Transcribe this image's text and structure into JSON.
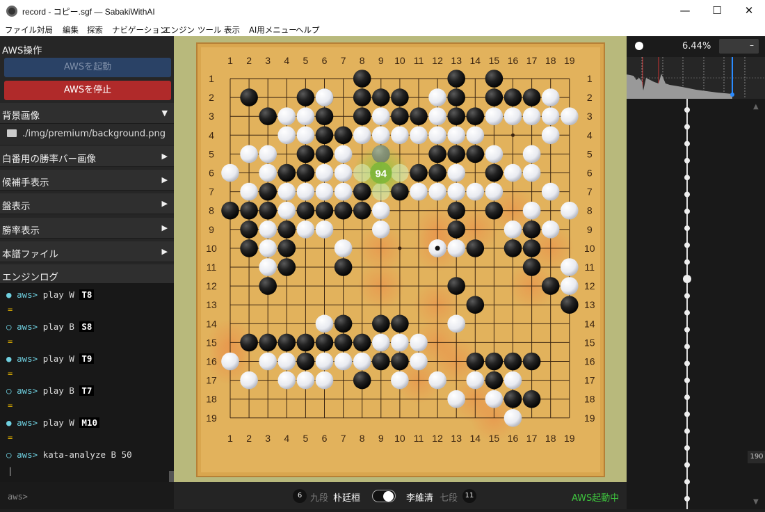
{
  "window": {
    "title": "record - コピー.sgf — SabakiWithAI",
    "minimize": "—",
    "maximize": "☐",
    "close": "✕"
  },
  "menu": [
    "ファイル",
    "対局",
    "編集",
    "探索",
    "ナビゲーション",
    "エンジン",
    "ツール",
    "表示",
    "AI用メニュー",
    "ヘルプ"
  ],
  "sidebar": {
    "aws_header": "AWS操作",
    "start_button": "AWSを起動",
    "stop_button": "AWSを停止",
    "background_header": "背景画像",
    "background_path": "./img/premium/background.png",
    "sections": [
      "白番用の勝率バー画像",
      "候補手表示",
      "盤表示",
      "勝率表示",
      "本譜ファイル"
    ],
    "log_header": "エンジンログ",
    "log": [
      {
        "dot": "●",
        "prefix": "aws>",
        "cmd": "play W",
        "arg": "T8"
      },
      {
        "eq": "="
      },
      {
        "dot": "○",
        "prefix": "aws>",
        "cmd": "play B",
        "arg": "S8"
      },
      {
        "eq": "="
      },
      {
        "dot": "●",
        "prefix": "aws>",
        "cmd": "play W",
        "arg": "T9"
      },
      {
        "eq": "="
      },
      {
        "dot": "○",
        "prefix": "aws>",
        "cmd": "play B",
        "arg": "T7"
      },
      {
        "eq": "="
      },
      {
        "dot": "●",
        "prefix": "aws>",
        "cmd": "play W",
        "arg": "M10"
      },
      {
        "eq": "="
      },
      {
        "dot": "○",
        "prefix": "aws>",
        "cmd": "kata-analyze B 50",
        "arg": ""
      }
    ],
    "console_prompt": "aws>",
    "cursor": "|"
  },
  "board": {
    "size": 19,
    "candidate_label": "94",
    "candidate_point": [
      9,
      6
    ],
    "black": [
      [
        8,
        1
      ],
      [
        13,
        1
      ],
      [
        15,
        1
      ],
      [
        2,
        2
      ],
      [
        5,
        2
      ],
      [
        6,
        2
      ],
      [
        8,
        2
      ],
      [
        9,
        2
      ],
      [
        10,
        2
      ],
      [
        13,
        2
      ],
      [
        15,
        2
      ],
      [
        16,
        2
      ],
      [
        17,
        2
      ],
      [
        3,
        3
      ],
      [
        6,
        3
      ],
      [
        8,
        3
      ],
      [
        10,
        3
      ],
      [
        11,
        3
      ],
      [
        13,
        3
      ],
      [
        14,
        3
      ],
      [
        6,
        4
      ],
      [
        7,
        4
      ],
      [
        5,
        5
      ],
      [
        6,
        5
      ],
      [
        9,
        5
      ],
      [
        12,
        5
      ],
      [
        13,
        5
      ],
      [
        14,
        5
      ],
      [
        4,
        6
      ],
      [
        5,
        6
      ],
      [
        11,
        6
      ],
      [
        12,
        6
      ],
      [
        15,
        6
      ],
      [
        3,
        7
      ],
      [
        8,
        7
      ],
      [
        10,
        7
      ],
      [
        1,
        8
      ],
      [
        2,
        8
      ],
      [
        3,
        8
      ],
      [
        5,
        8
      ],
      [
        6,
        8
      ],
      [
        7,
        8
      ],
      [
        8,
        8
      ],
      [
        13,
        8
      ],
      [
        15,
        8
      ],
      [
        2,
        9
      ],
      [
        4,
        9
      ],
      [
        13,
        9
      ],
      [
        17,
        9
      ],
      [
        2,
        10
      ],
      [
        4,
        10
      ],
      [
        14,
        10
      ],
      [
        16,
        10
      ],
      [
        17,
        10
      ],
      [
        4,
        11
      ],
      [
        7,
        11
      ],
      [
        17,
        11
      ],
      [
        3,
        12
      ],
      [
        13,
        12
      ],
      [
        18,
        12
      ],
      [
        14,
        13
      ],
      [
        19,
        13
      ],
      [
        7,
        14
      ],
      [
        9,
        14
      ],
      [
        10,
        14
      ],
      [
        2,
        15
      ],
      [
        3,
        15
      ],
      [
        4,
        15
      ],
      [
        5,
        15
      ],
      [
        6,
        15
      ],
      [
        7,
        15
      ],
      [
        8,
        15
      ],
      [
        9,
        15
      ],
      [
        5,
        16
      ],
      [
        9,
        16
      ],
      [
        10,
        16
      ],
      [
        14,
        16
      ],
      [
        15,
        16
      ],
      [
        16,
        16
      ],
      [
        17,
        16
      ],
      [
        8,
        17
      ],
      [
        15,
        17
      ],
      [
        16,
        18
      ],
      [
        17,
        18
      ]
    ],
    "white": [
      [
        6,
        2
      ],
      [
        12,
        2
      ],
      [
        18,
        2
      ],
      [
        4,
        3
      ],
      [
        5,
        3
      ],
      [
        9,
        3
      ],
      [
        12,
        3
      ],
      [
        15,
        3
      ],
      [
        16,
        3
      ],
      [
        17,
        3
      ],
      [
        18,
        3
      ],
      [
        19,
        3
      ],
      [
        4,
        4
      ],
      [
        5,
        4
      ],
      [
        8,
        4
      ],
      [
        9,
        4
      ],
      [
        10,
        4
      ],
      [
        11,
        4
      ],
      [
        12,
        4
      ],
      [
        13,
        4
      ],
      [
        14,
        4
      ],
      [
        18,
        4
      ],
      [
        2,
        5
      ],
      [
        3,
        5
      ],
      [
        7,
        5
      ],
      [
        15,
        5
      ],
      [
        17,
        5
      ],
      [
        1,
        6
      ],
      [
        3,
        6
      ],
      [
        6,
        6
      ],
      [
        7,
        6
      ],
      [
        13,
        6
      ],
      [
        16,
        6
      ],
      [
        17,
        6
      ],
      [
        2,
        7
      ],
      [
        4,
        7
      ],
      [
        5,
        7
      ],
      [
        6,
        7
      ],
      [
        7,
        7
      ],
      [
        11,
        7
      ],
      [
        12,
        7
      ],
      [
        13,
        7
      ],
      [
        14,
        7
      ],
      [
        15,
        7
      ],
      [
        18,
        7
      ],
      [
        4,
        8
      ],
      [
        9,
        8
      ],
      [
        17,
        8
      ],
      [
        19,
        8
      ],
      [
        3,
        9
      ],
      [
        5,
        9
      ],
      [
        6,
        9
      ],
      [
        9,
        9
      ],
      [
        16,
        9
      ],
      [
        18,
        9
      ],
      [
        3,
        10
      ],
      [
        7,
        10
      ],
      [
        12,
        10
      ],
      [
        13,
        10
      ],
      [
        3,
        11
      ],
      [
        19,
        11
      ],
      [
        19,
        12
      ],
      [
        13,
        14
      ],
      [
        6,
        14
      ],
      [
        9,
        15
      ],
      [
        10,
        15
      ],
      [
        11,
        15
      ],
      [
        1,
        16
      ],
      [
        3,
        16
      ],
      [
        4,
        16
      ],
      [
        6,
        16
      ],
      [
        7,
        16
      ],
      [
        8,
        16
      ],
      [
        11,
        16
      ],
      [
        2,
        17
      ],
      [
        4,
        17
      ],
      [
        5,
        17
      ],
      [
        6,
        17
      ],
      [
        10,
        17
      ],
      [
        12,
        17
      ],
      [
        14,
        17
      ],
      [
        16,
        17
      ],
      [
        13,
        18
      ],
      [
        15,
        18
      ],
      [
        16,
        19
      ]
    ],
    "hints": [
      [
        9,
        5
      ],
      [
        8,
        6
      ],
      [
        10,
        6
      ],
      [
        9,
        7
      ]
    ],
    "last_move": [
      12,
      10
    ],
    "colors": {
      "wood": "#e2b25c",
      "frame": "#d9a64e",
      "line": "#3a2410",
      "tatami": "#b8b97c",
      "candidate": "#8cbf3a"
    }
  },
  "players": {
    "black_count": "6",
    "black_rank": "九段",
    "black_name": "朴廷桓",
    "white_name": "李維清",
    "white_rank": "七段",
    "white_count": "11",
    "status": "AWS起動中"
  },
  "rightpanel": {
    "winrate": "6.44%",
    "dash": "–",
    "move_number": "190"
  }
}
